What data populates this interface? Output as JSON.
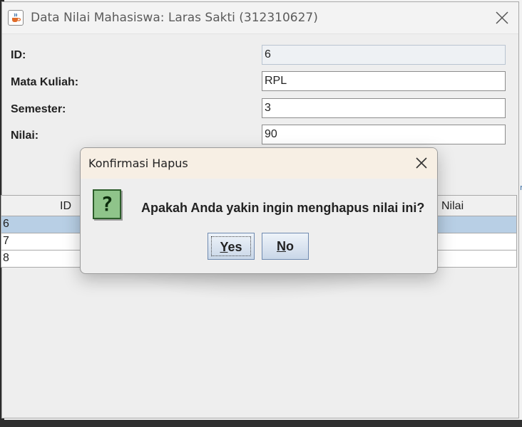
{
  "window": {
    "title": "Data Nilai Mahasiswa: Laras Sakti (312310627)",
    "app_icon": "java-cup-icon",
    "close_icon": "close-icon"
  },
  "form": {
    "fields": [
      {
        "label": "ID:",
        "value": "6",
        "readonly": true
      },
      {
        "label": "Mata Kuliah:",
        "value": "RPL"
      },
      {
        "label": "Semester:",
        "value": "3"
      },
      {
        "label": "Nilai:",
        "value": "90"
      }
    ]
  },
  "table": {
    "headers": [
      "ID",
      "Nilai"
    ],
    "rows": [
      {
        "id": "6",
        "selected": true
      },
      {
        "id": "7"
      },
      {
        "id": "8"
      }
    ],
    "selection_color": "#b8cfe5"
  },
  "dialog": {
    "title": "Konfirmasi Hapus",
    "icon": "question-icon",
    "icon_glyph": "?",
    "message": "Apakah Anda yakin ingin menghapus nilai ini?",
    "yes_mnemonic": "Y",
    "yes_rest": "es",
    "no_mnemonic": "N",
    "no_rest": "o",
    "titlebar_color": "#f7efe4"
  }
}
